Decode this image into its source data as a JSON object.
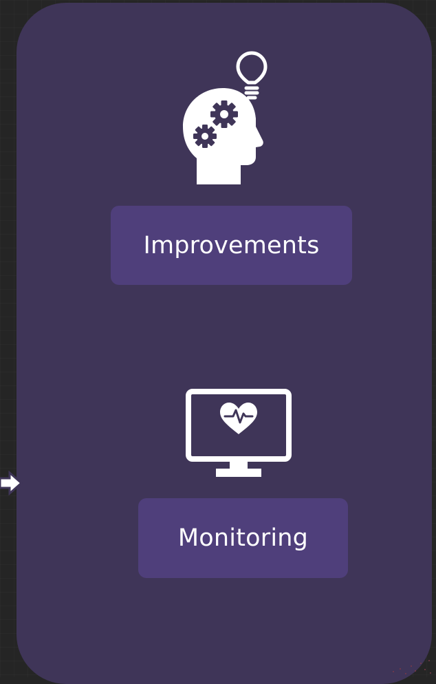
{
  "flow": {
    "improvements": {
      "label": "Improvements",
      "icon": "head-gears-lightbulb-icon"
    },
    "monitoring": {
      "label": "Monitoring",
      "icon": "monitor-heartbeat-icon"
    },
    "incoming_arrow_icon": "arrow-right-icon"
  },
  "colors": {
    "background": "#252525",
    "panel": "#3f3558",
    "label_box": "#4f3f7b",
    "text": "#ffffff",
    "icon": "#ffffff"
  }
}
